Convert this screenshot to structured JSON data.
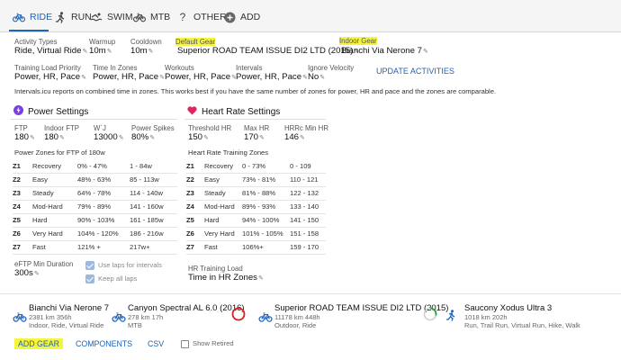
{
  "tabs": [
    {
      "label": "RIDE",
      "icon": "bike-icon"
    },
    {
      "label": "RUN",
      "icon": "run-icon"
    },
    {
      "label": "SWIM",
      "icon": "swim-icon"
    },
    {
      "label": "MTB",
      "icon": "bike-icon"
    },
    {
      "label": "OTHER",
      "icon": "question-icon"
    },
    {
      "label": "ADD",
      "icon": "plus-circle-icon"
    }
  ],
  "settings": {
    "activity_types": {
      "label": "Activity Types",
      "value": "Ride, Virtual Ride"
    },
    "warmup": {
      "label": "Warmup",
      "value": "10m"
    },
    "cooldown": {
      "label": "Cooldown",
      "value": "10m"
    },
    "default_gear": {
      "label": "Default Gear",
      "value": "Superior ROAD TEAM ISSUE DI2 LTD (2015)"
    },
    "indoor_gear": {
      "label": "Indoor Gear",
      "value": "Bianchi Via Nerone 7"
    },
    "training_load_priority": {
      "label": "Training Load Priority",
      "value": "Power, HR, Pace"
    },
    "time_in_zones": {
      "label": "Time In Zones",
      "value": "Power, HR, Pace"
    },
    "workouts": {
      "label": "Workouts",
      "value": "Power, HR, Pace"
    },
    "intervals": {
      "label": "Intervals",
      "value": "Power, HR, Pace"
    },
    "ignore_velocity": {
      "label": "Ignore Velocity",
      "value": "No"
    },
    "update_activities": "UPDATE ACTIVITIES",
    "note": "Intervals.icu reports on combined time in zones. This works best if you have the same number of zones for power, HR and pace and the zones are comparable."
  },
  "power": {
    "title": "Power Settings",
    "ftp": {
      "label": "FTP",
      "value": "180"
    },
    "indoor_ftp": {
      "label": "Indoor FTP",
      "value": "180"
    },
    "wj": {
      "label": "W`J",
      "value": "13000"
    },
    "power_spikes": {
      "label": "Power Spikes",
      "value": "80%"
    },
    "zones_title": "Power Zones for FTP of 180w",
    "zones": [
      {
        "z": "Z1",
        "name": "Recovery",
        "pct": "0% - 47%",
        "watts": "1 - 84w"
      },
      {
        "z": "Z2",
        "name": "Easy",
        "pct": "48% - 63%",
        "watts": "85 - 113w"
      },
      {
        "z": "Z3",
        "name": "Steady",
        "pct": "64% - 78%",
        "watts": "114 - 140w"
      },
      {
        "z": "Z4",
        "name": "Mod-Hard",
        "pct": "79% - 89%",
        "watts": "141 - 160w"
      },
      {
        "z": "Z5",
        "name": "Hard",
        "pct": "90% - 103%",
        "watts": "161 - 185w"
      },
      {
        "z": "Z6",
        "name": "Very Hard",
        "pct": "104% - 120%",
        "watts": "186 - 216w"
      },
      {
        "z": "Z7",
        "name": "Fast",
        "pct": "121% +",
        "watts": "217w+"
      }
    ],
    "eftp_label": "eFTP Min Duration",
    "eftp_value": "300s",
    "use_laps": "Use laps for intervals",
    "keep_laps": "Keep all laps"
  },
  "hr": {
    "title": "Heart Rate Settings",
    "threshold": {
      "label": "Threshold HR",
      "value": "150"
    },
    "max": {
      "label": "Max HR",
      "value": "170"
    },
    "hrrc": {
      "label": "HRRc Min HR",
      "value": "146"
    },
    "zones_title": "Heart Rate Training Zones",
    "zones": [
      {
        "z": "Z1",
        "name": "Recovery",
        "pct": "0 - 73%",
        "bpm": "0 - 109"
      },
      {
        "z": "Z2",
        "name": "Easy",
        "pct": "73% - 81%",
        "bpm": "110 - 121"
      },
      {
        "z": "Z3",
        "name": "Steady",
        "pct": "81% - 88%",
        "bpm": "122 - 132"
      },
      {
        "z": "Z4",
        "name": "Mod-Hard",
        "pct": "89% - 93%",
        "bpm": "133 - 140"
      },
      {
        "z": "Z5",
        "name": "Hard",
        "pct": "94% - 100%",
        "bpm": "141 - 150"
      },
      {
        "z": "Z6",
        "name": "Very Hard",
        "pct": "101% - 105%",
        "bpm": "151 - 158"
      },
      {
        "z": "Z7",
        "name": "Fast",
        "pct": "106%+",
        "bpm": "159 - 170"
      }
    ],
    "load_label": "HR Training Load",
    "load_value": "Time in HR Zones"
  },
  "gear": [
    {
      "name": "Bianchi Via Nerone 7",
      "stats": "2381 km  356h",
      "types": "Indoor, Ride, Virtual Ride"
    },
    {
      "name": "Canyon Spectral AL 6.0 (2016)",
      "stats": "278 km  17h",
      "types": "MTB"
    },
    {
      "name": "Superior ROAD TEAM ISSUE DI2 LTD (2015)",
      "stats": "11178 km  448h",
      "types": "Outdoor, Ride"
    },
    {
      "name": "Saucony Xodus Ultra 3",
      "stats": "1018 km  202h",
      "types": "Run, Trail Run, Virtual Run, Hike, Walk"
    }
  ],
  "footer": {
    "add_gear": "ADD GEAR",
    "components": "COMPONENTS",
    "csv": "CSV",
    "show_retired": "Show Retired"
  },
  "colors": {
    "accent": "#1e63b7",
    "highlight": "#f6f53d",
    "power": "#7b3fe4",
    "heart": "#e0245e",
    "ring_red": "#d62020",
    "ring_green": "#2e9b3a"
  }
}
